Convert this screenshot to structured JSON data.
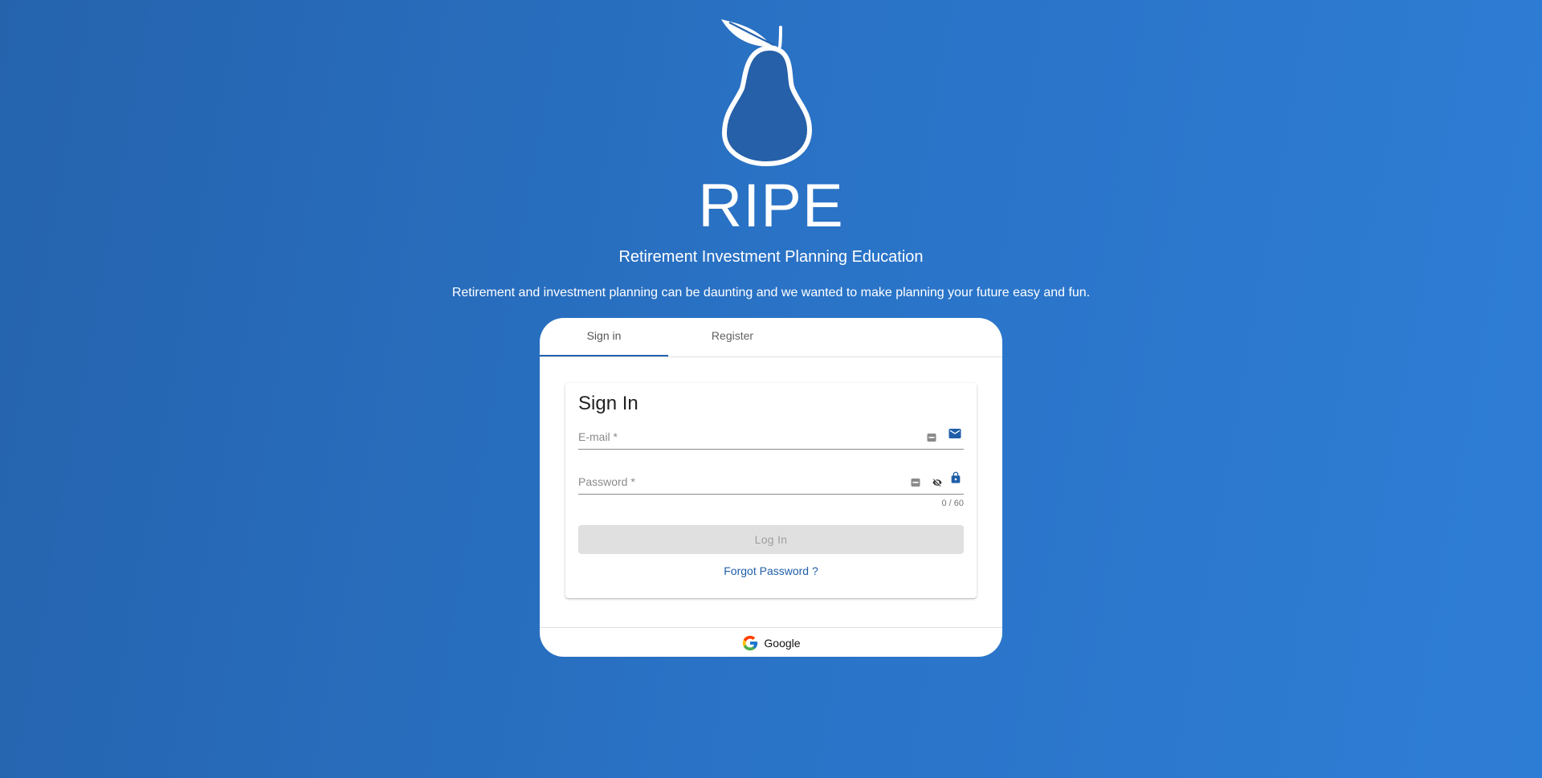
{
  "brand": {
    "name": "RIPE",
    "logo_icon": "pear-icon",
    "tagline": "Retirement Investment Planning Education",
    "description": "Retirement and investment planning can be daunting and we wanted to make planning your future easy and fun."
  },
  "tabs": [
    {
      "label": "Sign in",
      "active": true
    },
    {
      "label": "Register",
      "active": false
    }
  ],
  "signin": {
    "title": "Sign In",
    "email": {
      "placeholder": "E-mail *",
      "value": "",
      "icon": "mail-icon"
    },
    "password": {
      "placeholder": "Password *",
      "value": "",
      "icon": "lock-icon",
      "counter": "0 / 60"
    },
    "login_label": "Log In",
    "forgot_label": "Forgot Password ?"
  },
  "social": {
    "google_label": "Google"
  },
  "colors": {
    "background": "#2a6fc0",
    "accent": "#2563ad",
    "link": "#1f5ea8"
  }
}
